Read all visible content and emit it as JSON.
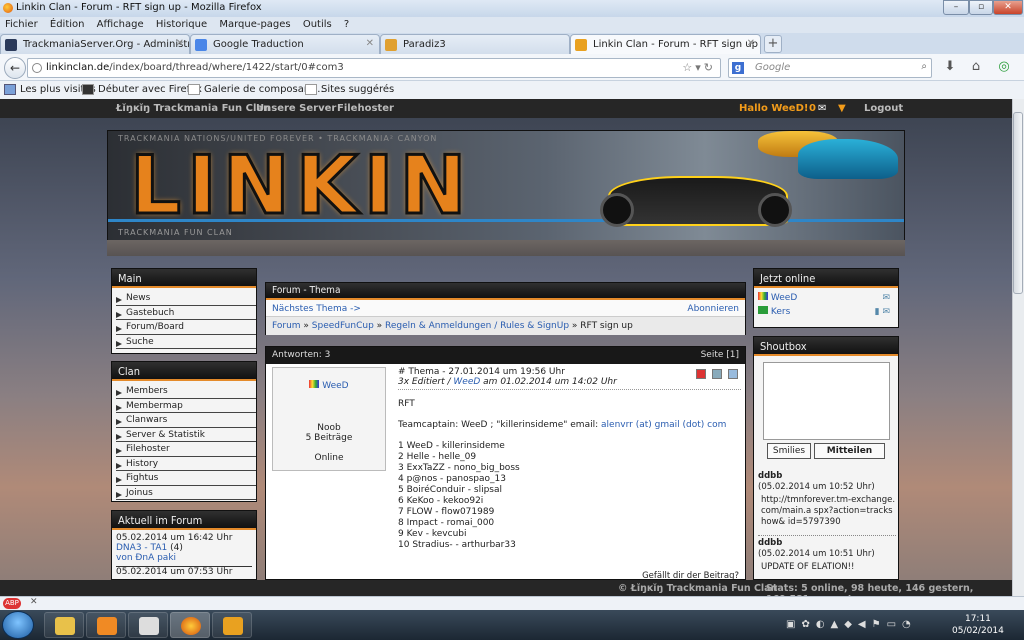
{
  "window": {
    "title": "Linkin Clan - Forum - RFT sign up - Mozilla Firefox"
  },
  "menubar": [
    "Fichier",
    "Édition",
    "Affichage",
    "Historique",
    "Marque-pages",
    "Outils",
    "?"
  ],
  "tabs": [
    {
      "label": "TrackmaniaServer.Org - Administration"
    },
    {
      "label": "Google Traduction"
    },
    {
      "label": "Paradiz3"
    },
    {
      "label": "Linkin Clan - Forum - RFT sign up"
    }
  ],
  "nav": {
    "url_host": "linkinclan.de",
    "url_path": "/index/board/thread/where/1422/start/0#com3",
    "search_placeholder": "Google"
  },
  "bookmarks": [
    "Les plus visités",
    "Débuter avec Firefox",
    "Galerie de composant...",
    "Sites suggérés"
  ],
  "site_nav": {
    "brand": "Łĭŋĸĭŋ Trackmania Fun Clan",
    "links": [
      "Unsere Server",
      "Filehoster"
    ],
    "greeting": "Hallo WeeD!",
    "messages": "0",
    "logout": "Logout"
  },
  "banner": {
    "topline": "TRACKMANIA NATIONS/UNITED FOREVER • TRACKMANIA² CANYON",
    "logo": "LINKIN",
    "sub": "TRACKMANIA FUN CLAN"
  },
  "main_panel": {
    "title": "Main",
    "items": [
      "News",
      "Gastebuch",
      "Forum/Board",
      "Suche"
    ]
  },
  "clan_panel": {
    "title": "Clan",
    "items": [
      "Members",
      "Membermap",
      "Clanwars",
      "Server & Statistik",
      "Filehoster",
      "History",
      "Fightus",
      "Joinus"
    ]
  },
  "aktuell_panel": {
    "title": "Aktuell im Forum",
    "entries": [
      {
        "date": "05.02.2014 um 16:42 Uhr",
        "topic": "DNA3 - TA1",
        "count": "(4)",
        "by": "von ÐnA paki"
      },
      {
        "date": "05.02.2014 um 07:53 Uhr"
      }
    ]
  },
  "thema": {
    "title": "Forum - Thema",
    "next": "Nächstes Thema ->",
    "subscribe": "Abonnieren",
    "breadcrumb": [
      "Forum",
      "SpeedFunCup",
      "Regeln & Anmeldungen / Rules & SignUp",
      "RFT sign up"
    ]
  },
  "post": {
    "answers": "Antworten: 3",
    "page": "Seite [1]",
    "user": {
      "name": "WeeD",
      "rank": "Noob",
      "posts": "5 Beiträge",
      "status": "Online"
    },
    "meta1": "# Thema - 27.01.2014 um 19:56 Uhr",
    "meta2_prefix": "3x Editiert /",
    "meta2_user": "WeeD",
    "meta2_suffix": "am 01.02.2014 um 14:02 Uhr",
    "title": "RFT",
    "captain_text": "Teamcaptain: WeeD ; \"killerinsideme\" email:",
    "captain_email": "alenvrr (at) gmail (dot) com",
    "players": [
      "1 WeeD - killerinsideme",
      "2 Helle - helle_09",
      "3 ExxTaZZ - nono_big_boss",
      "4 p@nos - panospao_13",
      "5 BoiréConduir - slipsal",
      "6 KeKoo - kekoo92i",
      "7 FLOW - flow071989",
      "8 Impact - romai_000",
      "9 Kev - kevcubi",
      "10 Stradius- - arthurbar33"
    ],
    "like": "Gefällt dir der Beitrag?"
  },
  "online_panel": {
    "title": "Jetzt online",
    "users": [
      "WeeD",
      "Kers"
    ]
  },
  "shoutbox": {
    "title": "Shoutbox",
    "smilies": "Smilies",
    "send": "Mitteilen",
    "shouts": [
      {
        "user": "ddbb",
        "time": "(05.02.2014 um 10:52 Uhr)",
        "text": "http://tmnforever.tm-exchange.com/main.a spx?action=trackshow& id=5797390"
      },
      {
        "user": "ddbb",
        "time": "(05.02.2014 um 10:51 Uhr)",
        "text": "UPDATE OF ELATION!!"
      }
    ]
  },
  "footer": {
    "copyright": "© Łĭŋĸĭŋ Trackmania Fun Clan",
    "stats": "Stats: 5 online, 98 heute, 146 gestern, 169.581 gesamt"
  },
  "taskbar": {
    "time": "17:11",
    "date": "05/02/2014"
  }
}
